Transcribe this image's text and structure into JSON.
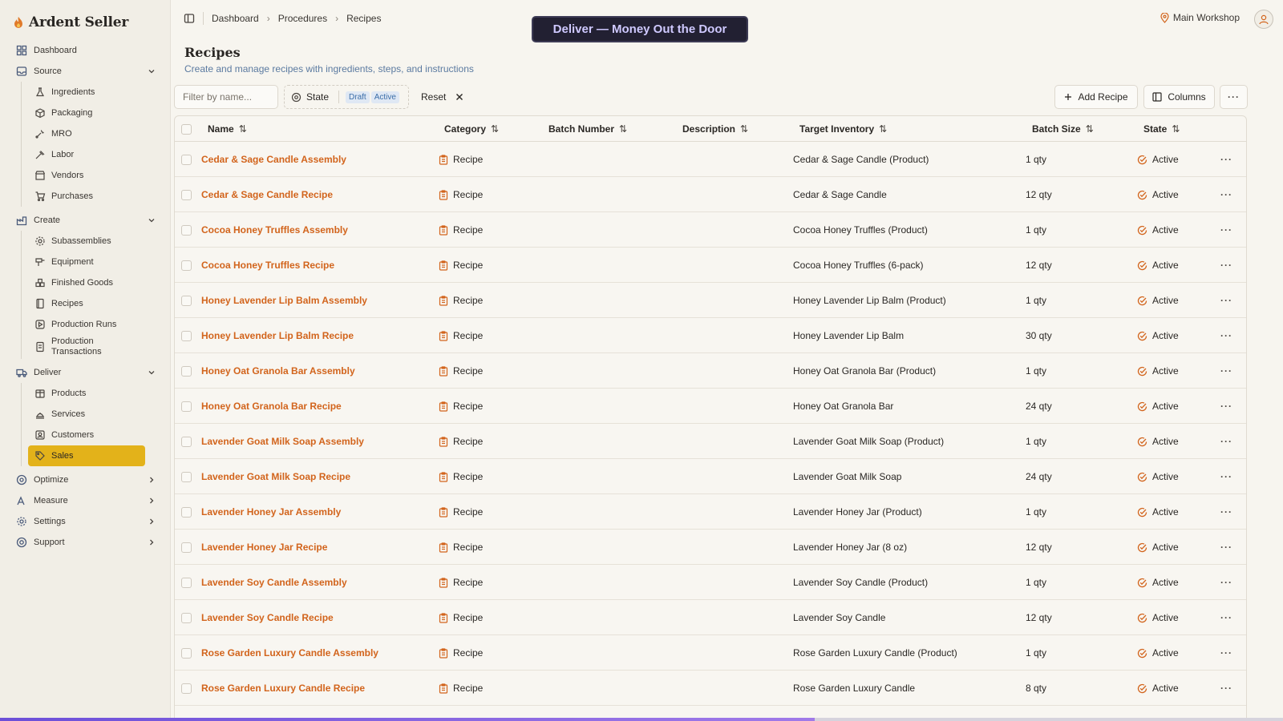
{
  "app": {
    "name": "Ardent Seller"
  },
  "sidebar": {
    "dashboard": "Dashboard",
    "groups": [
      {
        "label": "Source",
        "icon": "inbox-icon",
        "expanded": true,
        "items": [
          {
            "label": "Ingredients",
            "icon": "flask-icon"
          },
          {
            "label": "Packaging",
            "icon": "package-icon"
          },
          {
            "label": "MRO",
            "icon": "wrench-icon"
          },
          {
            "label": "Labor",
            "icon": "hammer-icon"
          },
          {
            "label": "Vendors",
            "icon": "vendor-icon"
          },
          {
            "label": "Purchases",
            "icon": "cart-icon"
          }
        ]
      },
      {
        "label": "Create",
        "icon": "factory-icon",
        "expanded": true,
        "items": [
          {
            "label": "Subassemblies",
            "icon": "gear-icon"
          },
          {
            "label": "Equipment",
            "icon": "drill-icon"
          },
          {
            "label": "Finished Goods",
            "icon": "boxes-icon"
          },
          {
            "label": "Recipes",
            "icon": "book-icon"
          },
          {
            "label": "Production Runs",
            "icon": "play-icon"
          },
          {
            "label": "Production Transactions",
            "icon": "doc-icon"
          }
        ]
      },
      {
        "label": "Deliver",
        "icon": "truck-icon",
        "expanded": true,
        "items": [
          {
            "label": "Products",
            "icon": "box-icon"
          },
          {
            "label": "Services",
            "icon": "service-icon"
          },
          {
            "label": "Customers",
            "icon": "customers-icon"
          },
          {
            "label": "Sales",
            "icon": "tag-icon",
            "active": true
          }
        ]
      }
    ],
    "collapsed": [
      {
        "label": "Optimize",
        "icon": "target-icon"
      },
      {
        "label": "Measure",
        "icon": "chart-icon"
      },
      {
        "label": "Settings",
        "icon": "gear-icon"
      },
      {
        "label": "Support",
        "icon": "help-icon"
      }
    ]
  },
  "breadcrumb": [
    "Dashboard",
    "Procedures",
    "Recipes"
  ],
  "banner": "Deliver — Money Out the Door",
  "location": "Main Workshop",
  "page": {
    "title": "Recipes",
    "subtitle": "Create and manage recipes with ingredients, steps, and instructions"
  },
  "toolbar": {
    "filter_placeholder": "Filter by name...",
    "state_label": "State",
    "state_chips": [
      "Draft",
      "Active"
    ],
    "reset_label": "Reset",
    "add_label": "Add Recipe",
    "columns_label": "Columns"
  },
  "table": {
    "columns": [
      "Name",
      "Category",
      "Batch Number",
      "Description",
      "Target Inventory",
      "Batch Size",
      "State"
    ],
    "rows": [
      {
        "name": "Cedar & Sage Candle Assembly",
        "category": "Recipe",
        "batch_number": "",
        "description": "",
        "target": "Cedar & Sage Candle (Product)",
        "batch_size": "1 qty",
        "state": "Active"
      },
      {
        "name": "Cedar & Sage Candle Recipe",
        "category": "Recipe",
        "batch_number": "",
        "description": "",
        "target": "Cedar & Sage Candle",
        "batch_size": "12 qty",
        "state": "Active"
      },
      {
        "name": "Cocoa Honey Truffles Assembly",
        "category": "Recipe",
        "batch_number": "",
        "description": "",
        "target": "Cocoa Honey Truffles (Product)",
        "batch_size": "1 qty",
        "state": "Active"
      },
      {
        "name": "Cocoa Honey Truffles Recipe",
        "category": "Recipe",
        "batch_number": "",
        "description": "",
        "target": "Cocoa Honey Truffles (6-pack)",
        "batch_size": "12 qty",
        "state": "Active"
      },
      {
        "name": "Honey Lavender Lip Balm Assembly",
        "category": "Recipe",
        "batch_number": "",
        "description": "",
        "target": "Honey Lavender Lip Balm (Product)",
        "batch_size": "1 qty",
        "state": "Active"
      },
      {
        "name": "Honey Lavender Lip Balm Recipe",
        "category": "Recipe",
        "batch_number": "",
        "description": "",
        "target": "Honey Lavender Lip Balm",
        "batch_size": "30 qty",
        "state": "Active"
      },
      {
        "name": "Honey Oat Granola Bar Assembly",
        "category": "Recipe",
        "batch_number": "",
        "description": "",
        "target": "Honey Oat Granola Bar (Product)",
        "batch_size": "1 qty",
        "state": "Active"
      },
      {
        "name": "Honey Oat Granola Bar Recipe",
        "category": "Recipe",
        "batch_number": "",
        "description": "",
        "target": "Honey Oat Granola Bar",
        "batch_size": "24 qty",
        "state": "Active"
      },
      {
        "name": "Lavender Goat Milk Soap Assembly",
        "category": "Recipe",
        "batch_number": "",
        "description": "",
        "target": "Lavender Goat Milk Soap (Product)",
        "batch_size": "1 qty",
        "state": "Active"
      },
      {
        "name": "Lavender Goat Milk Soap Recipe",
        "category": "Recipe",
        "batch_number": "",
        "description": "",
        "target": "Lavender Goat Milk Soap",
        "batch_size": "24 qty",
        "state": "Active"
      },
      {
        "name": "Lavender Honey Jar Assembly",
        "category": "Recipe",
        "batch_number": "",
        "description": "",
        "target": "Lavender Honey Jar (Product)",
        "batch_size": "1 qty",
        "state": "Active"
      },
      {
        "name": "Lavender Honey Jar Recipe",
        "category": "Recipe",
        "batch_number": "",
        "description": "",
        "target": "Lavender Honey Jar (8 oz)",
        "batch_size": "12 qty",
        "state": "Active"
      },
      {
        "name": "Lavender Soy Candle Assembly",
        "category": "Recipe",
        "batch_number": "",
        "description": "",
        "target": "Lavender Soy Candle (Product)",
        "batch_size": "1 qty",
        "state": "Active"
      },
      {
        "name": "Lavender Soy Candle Recipe",
        "category": "Recipe",
        "batch_number": "",
        "description": "",
        "target": "Lavender Soy Candle",
        "batch_size": "12 qty",
        "state": "Active"
      },
      {
        "name": "Rose Garden Luxury Candle Assembly",
        "category": "Recipe",
        "batch_number": "",
        "description": "",
        "target": "Rose Garden Luxury Candle (Product)",
        "batch_size": "1 qty",
        "state": "Active"
      },
      {
        "name": "Rose Garden Luxury Candle Recipe",
        "category": "Recipe",
        "batch_number": "",
        "description": "",
        "target": "Rose Garden Luxury Candle",
        "batch_size": "8 qty",
        "state": "Active"
      }
    ]
  },
  "colors": {
    "accent": "#d2641c",
    "active_nav": "#e3b21a",
    "banner_bg": "#222032",
    "link": "#5b7aa0"
  },
  "progress": 0.635
}
